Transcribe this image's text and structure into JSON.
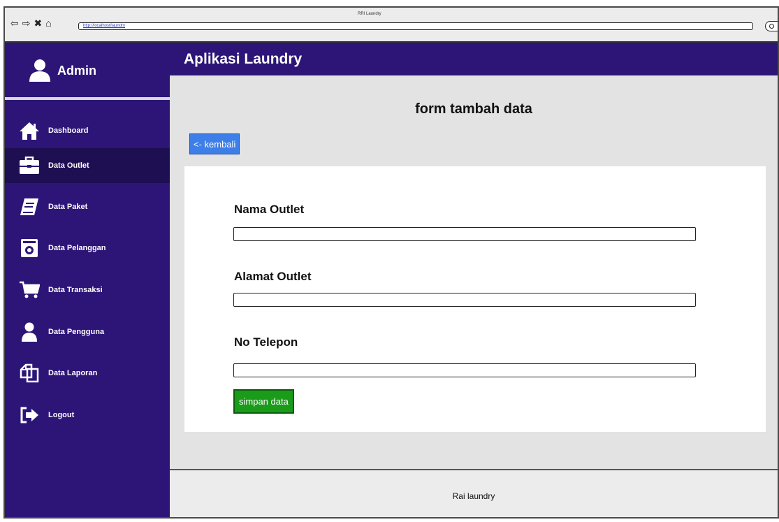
{
  "browser": {
    "window_title": "RRI Laundry",
    "url": "http://localhost/laundry"
  },
  "sidebar": {
    "user_label": "Admin",
    "items": [
      {
        "label": "Dashboard",
        "icon": "home-icon"
      },
      {
        "label": "Data Outlet",
        "icon": "briefcase-icon",
        "active": true
      },
      {
        "label": "Data Paket",
        "icon": "book-icon"
      },
      {
        "label": "Data Pelanggan",
        "icon": "safe-icon"
      },
      {
        "label": "Data Transaksi",
        "icon": "cart-icon"
      },
      {
        "label": "Data Pengguna",
        "icon": "user-icon"
      },
      {
        "label": "Data Laporan",
        "icon": "copy-icon"
      },
      {
        "label": "Logout",
        "icon": "logout-icon"
      }
    ]
  },
  "header": {
    "app_title": "Aplikasi Laundry"
  },
  "main": {
    "form_title": "form tambah data",
    "back_label": "<- kembali",
    "fields": [
      {
        "label": "Nama Outlet",
        "value": ""
      },
      {
        "label": "Alamat Outlet",
        "value": ""
      },
      {
        "label": "No Telepon",
        "value": ""
      }
    ],
    "save_label": "simpan data"
  },
  "footer": {
    "text": "Rai laundry"
  },
  "colors": {
    "sidebar_bg": "#2d1578",
    "sidebar_active": "#1e0e52",
    "back_button": "#3d7ee8",
    "save_button": "#1a9b1a"
  }
}
